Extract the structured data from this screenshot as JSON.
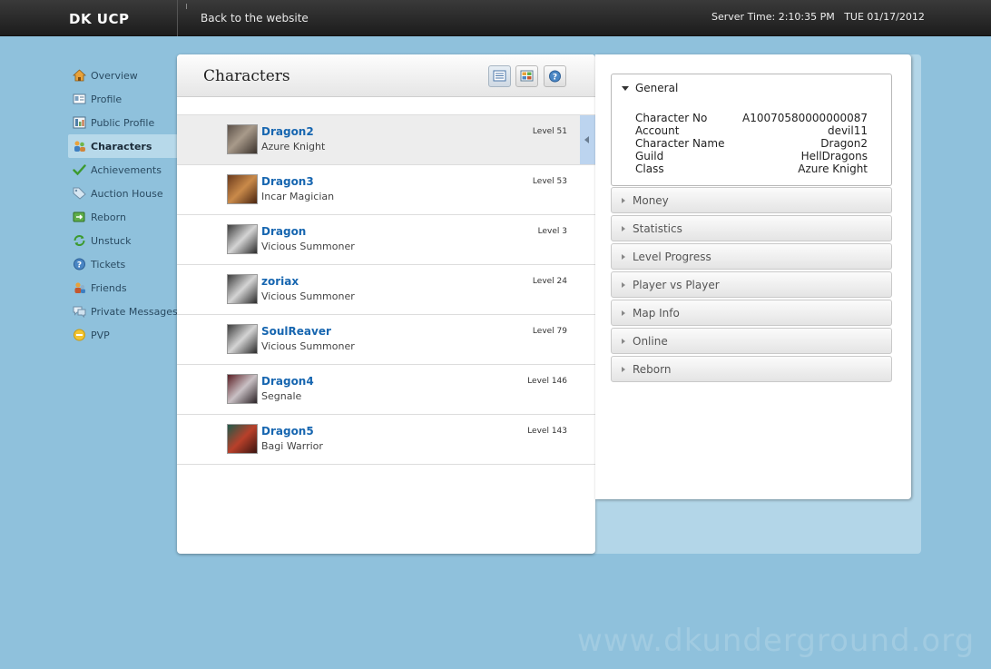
{
  "topbar": {
    "brand": "DK UCP",
    "back_link": "Back to the website",
    "server_time": "Server Time: 2:10:35 PM   TUE 01/17/2012"
  },
  "sidebar": {
    "items": [
      {
        "label": "Overview",
        "icon": "home-icon"
      },
      {
        "label": "Profile",
        "icon": "profile-card-icon"
      },
      {
        "label": "Public Profile",
        "icon": "public-profile-icon"
      },
      {
        "label": "Characters",
        "icon": "characters-icon",
        "active": true
      },
      {
        "label": "Achievements",
        "icon": "checkmark-icon"
      },
      {
        "label": "Auction House",
        "icon": "tag-icon"
      },
      {
        "label": "Reborn",
        "icon": "reborn-icon"
      },
      {
        "label": "Unstuck",
        "icon": "refresh-icon"
      },
      {
        "label": "Tickets",
        "icon": "help-icon"
      },
      {
        "label": "Friends",
        "icon": "friends-icon"
      },
      {
        "label": "Private Messages",
        "icon": "messages-icon"
      },
      {
        "label": "PVP",
        "icon": "pvp-icon"
      }
    ]
  },
  "characters_panel": {
    "title": "Characters",
    "buttons": [
      "list-view-icon",
      "grid-view-icon",
      "help-icon"
    ],
    "characters": [
      {
        "name": "Dragon2",
        "class": "Azure Knight",
        "level": "Level 51"
      },
      {
        "name": "Dragon3",
        "class": "Incar Magician",
        "level": "Level 53"
      },
      {
        "name": "Dragon",
        "class": "Vicious Summoner",
        "level": "Level 3"
      },
      {
        "name": "zoriax",
        "class": "Vicious Summoner",
        "level": "Level 24"
      },
      {
        "name": "SoulReaver",
        "class": "Vicious Summoner",
        "level": "Level 79"
      },
      {
        "name": "Dragon4",
        "class": "Segnale",
        "level": "Level 146"
      },
      {
        "name": "Dragon5",
        "class": "Bagi Warrior",
        "level": "Level 143"
      }
    ]
  },
  "details": {
    "general_title": "General",
    "fields": [
      {
        "label": "Character No",
        "value": "A10070580000000087"
      },
      {
        "label": "Account",
        "value": "devil11"
      },
      {
        "label": "Character Name",
        "value": "Dragon2"
      },
      {
        "label": "Guild",
        "value": "HellDragons"
      },
      {
        "label": "Class",
        "value": "Azure Knight"
      }
    ],
    "sections": [
      "Money",
      "Statistics",
      "Level Progress",
      "Player vs Player",
      "Map Info",
      "Online",
      "Reborn"
    ]
  },
  "watermark": "www.dkunderground.org",
  "colors": {
    "background": "#8fc1dc",
    "accent_link": "#1766b0",
    "topbar": "#2a2a2a"
  }
}
